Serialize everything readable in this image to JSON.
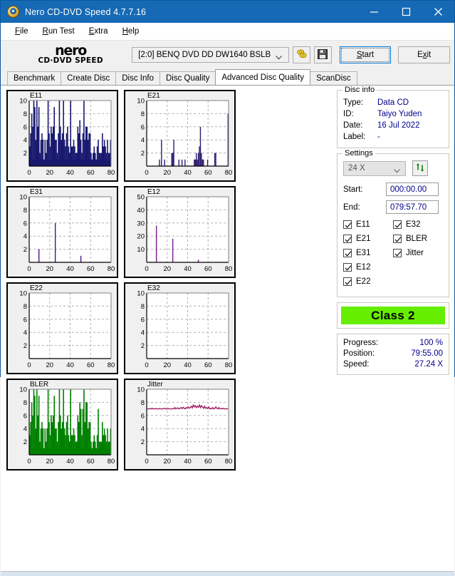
{
  "window": {
    "title": "Nero CD-DVD Speed 4.7.7.16",
    "icon": "nero-disc-icon",
    "minimize_label": "Minimize",
    "maximize_label": "Maximize",
    "close_label": "Close"
  },
  "menu": [
    {
      "label": "File",
      "accel": "F"
    },
    {
      "label": "Run Test",
      "accel": "R"
    },
    {
      "label": "Extra",
      "accel": "E"
    },
    {
      "label": "Help",
      "accel": "H"
    }
  ],
  "toolbar": {
    "logo_main": "nero",
    "logo_sub": "CD·DVD SPEED",
    "drive_value": "[2:0]   BENQ DVD DD DW1640 BSLB",
    "eject_icon": "eject-disc-icon",
    "save_icon": "floppy-save-icon",
    "start_label": "Start",
    "exit_label": "Exit"
  },
  "tabs": [
    {
      "label": "Benchmark",
      "active": false
    },
    {
      "label": "Create Disc",
      "active": false
    },
    {
      "label": "Disc Info",
      "active": false
    },
    {
      "label": "Disc Quality",
      "active": false
    },
    {
      "label": "Advanced Disc Quality",
      "active": true
    },
    {
      "label": "ScanDisc",
      "active": false
    }
  ],
  "disc_info": {
    "legend": "Disc info",
    "rows": [
      {
        "key": "Type:",
        "value": "Data CD"
      },
      {
        "key": "ID:",
        "value": "Taiyo Yuden"
      },
      {
        "key": "Date:",
        "value": "16 Jul 2022"
      },
      {
        "key": "Label:",
        "value": "-"
      }
    ]
  },
  "settings": {
    "legend": "Settings",
    "speed": "24 X",
    "refresh_icon": "refresh-icon",
    "start_label": "Start:",
    "start_value": "000:00.00",
    "end_label": "End:",
    "end_value": "079:57.70",
    "checks": [
      {
        "label": "E11",
        "checked": true
      },
      {
        "label": "E32",
        "checked": true
      },
      {
        "label": "E21",
        "checked": true
      },
      {
        "label": "BLER",
        "checked": true
      },
      {
        "label": "E31",
        "checked": true
      },
      {
        "label": "Jitter",
        "checked": true
      },
      {
        "label": "E12",
        "checked": true
      },
      {
        "label": "",
        "checked": null
      },
      {
        "label": "E22",
        "checked": true
      },
      {
        "label": "",
        "checked": null
      }
    ]
  },
  "quality": {
    "class_label": "Class 2",
    "class_color": "#66ee00"
  },
  "status": {
    "rows": [
      {
        "key": "Progress:",
        "value": "100 %"
      },
      {
        "key": "Position:",
        "value": "79:55.00"
      },
      {
        "key": "Speed:",
        "value": "27.24 X"
      }
    ]
  },
  "chart_data": [
    {
      "type": "bar",
      "title": "E11",
      "xlabel": "",
      "ylabel": "",
      "xlim": [
        0,
        80
      ],
      "ylim": [
        0,
        10
      ],
      "xticks": [
        0,
        20,
        40,
        60,
        80
      ],
      "yticks": [
        2,
        4,
        6,
        8,
        10
      ],
      "grid": true,
      "color": "#191970",
      "fill": true,
      "values": [
        3,
        5,
        8,
        6,
        10,
        9,
        4,
        10,
        6,
        9,
        2,
        4,
        5,
        4,
        1,
        4,
        2,
        4,
        10,
        5,
        3,
        6,
        5,
        6,
        9,
        4,
        4,
        2,
        5,
        10,
        6,
        4,
        5,
        10,
        4,
        3,
        5,
        6,
        3,
        2,
        10,
        3,
        3,
        4,
        3,
        2,
        2,
        6,
        5,
        7,
        4,
        2,
        5,
        10,
        4,
        6,
        6,
        4,
        5,
        5,
        2,
        1,
        2,
        3,
        2,
        1,
        3,
        4,
        2,
        2,
        2,
        5,
        3,
        4,
        3,
        2,
        4,
        2,
        2,
        4
      ]
    },
    {
      "type": "bar",
      "title": "E21",
      "xlabel": "",
      "ylabel": "",
      "xlim": [
        0,
        80
      ],
      "ylim": [
        0,
        10
      ],
      "xticks": [
        0,
        20,
        40,
        60,
        80
      ],
      "yticks": [
        2,
        4,
        6,
        8,
        10
      ],
      "grid": true,
      "color": "#2d1b6e",
      "fill": false,
      "values": [
        0,
        0,
        0,
        0,
        0,
        0,
        0,
        0,
        0,
        0,
        0,
        0,
        1,
        0,
        4,
        0,
        0,
        1,
        0,
        0,
        0,
        0,
        0,
        0,
        2,
        2,
        4,
        0,
        0,
        0,
        0,
        1,
        0,
        0,
        1,
        0,
        0,
        1,
        0,
        0,
        0,
        0,
        0,
        0,
        0,
        0,
        1,
        1,
        2,
        1,
        2,
        3,
        6,
        2,
        1,
        1,
        0,
        0,
        0,
        1,
        0,
        0,
        0,
        0,
        0,
        0,
        2,
        2,
        0,
        0,
        0,
        0,
        0,
        0,
        0,
        0,
        0,
        0,
        0,
        8
      ]
    },
    {
      "type": "bar",
      "title": "E31",
      "xlabel": "",
      "ylabel": "",
      "xlim": [
        0,
        80
      ],
      "ylim": [
        0,
        10
      ],
      "xticks": [
        0,
        20,
        40,
        60,
        80
      ],
      "yticks": [
        2,
        4,
        6,
        8,
        10
      ],
      "grid": true,
      "color": "#44168a",
      "fill": false,
      "values": [
        0,
        0,
        0,
        0,
        0,
        0,
        0,
        0,
        0,
        2,
        0,
        0,
        0,
        0,
        0,
        0,
        0,
        0,
        0,
        0,
        0,
        0,
        0,
        0,
        0,
        6,
        0,
        0,
        0,
        0,
        0,
        0,
        0,
        0,
        0,
        0,
        0,
        0,
        0,
        0,
        0,
        0,
        0,
        0,
        0,
        0,
        0,
        0,
        0,
        0,
        1,
        0,
        0,
        0,
        0,
        0,
        0,
        0,
        0,
        0,
        0,
        0,
        0,
        0,
        0,
        0,
        0,
        0,
        0,
        0,
        0,
        0,
        0,
        0,
        0,
        0,
        0,
        0,
        0,
        0
      ]
    },
    {
      "type": "bar",
      "title": "E12",
      "xlabel": "",
      "ylabel": "",
      "xlim": [
        0,
        80
      ],
      "ylim": [
        0,
        50
      ],
      "xticks": [
        0,
        20,
        40,
        60,
        80
      ],
      "yticks": [
        10,
        20,
        30,
        40,
        50
      ],
      "grid": true,
      "color": "#7a1d8f",
      "fill": false,
      "values": [
        0,
        0,
        0,
        0,
        0,
        0,
        0,
        0,
        0,
        28,
        0,
        0,
        0,
        0,
        0,
        0,
        0,
        0,
        0,
        0,
        0,
        0,
        0,
        0,
        0,
        18,
        0,
        0,
        0,
        0,
        0,
        0,
        0,
        0,
        0,
        0,
        0,
        0,
        0,
        0,
        0,
        0,
        0,
        0,
        0,
        0,
        0,
        0,
        0,
        0,
        2,
        0,
        0,
        0,
        0,
        0,
        0,
        0,
        0,
        0,
        0,
        0,
        0,
        0,
        0,
        0,
        0,
        0,
        0,
        0,
        0,
        0,
        0,
        0,
        0,
        0,
        0,
        0,
        0,
        0
      ]
    },
    {
      "type": "bar",
      "title": "E22",
      "xlabel": "",
      "ylabel": "",
      "xlim": [
        0,
        80
      ],
      "ylim": [
        0,
        10
      ],
      "xticks": [
        0,
        20,
        40,
        60,
        80
      ],
      "yticks": [
        2,
        4,
        6,
        8,
        10
      ],
      "grid": true,
      "color": "#191970",
      "fill": false,
      "values": []
    },
    {
      "type": "bar",
      "title": "E32",
      "xlabel": "",
      "ylabel": "",
      "xlim": [
        0,
        80
      ],
      "ylim": [
        0,
        10
      ],
      "xticks": [
        0,
        20,
        40,
        60,
        80
      ],
      "yticks": [
        2,
        4,
        6,
        8,
        10
      ],
      "grid": true,
      "color": "#191970",
      "fill": false,
      "values": []
    },
    {
      "type": "bar",
      "title": "BLER",
      "xlabel": "",
      "ylabel": "",
      "xlim": [
        0,
        80
      ],
      "ylim": [
        0,
        10
      ],
      "xticks": [
        0,
        20,
        40,
        60,
        80
      ],
      "yticks": [
        2,
        4,
        6,
        8,
        10
      ],
      "grid": true,
      "color": "#008000",
      "fill": true,
      "values": [
        3,
        5,
        8,
        6,
        10,
        9,
        4,
        10,
        6,
        9,
        2,
        4,
        5,
        4,
        1,
        4,
        2,
        4,
        10,
        5,
        3,
        6,
        5,
        6,
        9,
        4,
        4,
        2,
        5,
        10,
        6,
        4,
        5,
        10,
        4,
        3,
        5,
        6,
        3,
        2,
        10,
        3,
        3,
        4,
        3,
        2,
        2,
        6,
        5,
        8,
        7,
        3,
        7,
        10,
        5,
        8,
        8,
        4,
        5,
        5,
        2,
        1,
        2,
        3,
        2,
        1,
        3,
        7,
        2,
        2,
        2,
        5,
        3,
        4,
        3,
        2,
        4,
        2,
        2,
        4
      ]
    },
    {
      "type": "line",
      "title": "Jitter",
      "xlabel": "",
      "ylabel": "",
      "xlim": [
        0,
        80
      ],
      "ylim": [
        0,
        10
      ],
      "xticks": [
        0,
        20,
        40,
        60,
        80
      ],
      "yticks": [
        2,
        4,
        6,
        8,
        10
      ],
      "grid": true,
      "color": "#a02060",
      "fill": false,
      "values": [
        7.0,
        7.0,
        7.0,
        7.05,
        7.0,
        7.1,
        7.0,
        7.0,
        7.05,
        7.0,
        7.0,
        7.0,
        7.05,
        7.0,
        7.0,
        7.0,
        7.05,
        7.1,
        7.0,
        7.0,
        7.0,
        7.05,
        7.0,
        7.0,
        7.0,
        7.05,
        7.0,
        7.2,
        7.0,
        7.1,
        7.15,
        7.0,
        7.1,
        7.2,
        7.05,
        7.25,
        7.1,
        7.0,
        7.2,
        7.1,
        7.3,
        7.1,
        7.2,
        7.4,
        7.15,
        7.6,
        7.3,
        7.5,
        7.2,
        7.4,
        7.25,
        7.6,
        7.2,
        7.5,
        7.3,
        7.1,
        7.4,
        7.1,
        7.2,
        7.05,
        7.3,
        7.0,
        7.1,
        7.0,
        7.2,
        7.0,
        7.05,
        7.3,
        7.1,
        7.0,
        7.2,
        7.0,
        7.05,
        7.0,
        7.1,
        7.0,
        7.0,
        7.05,
        7.0,
        7.0
      ]
    }
  ]
}
